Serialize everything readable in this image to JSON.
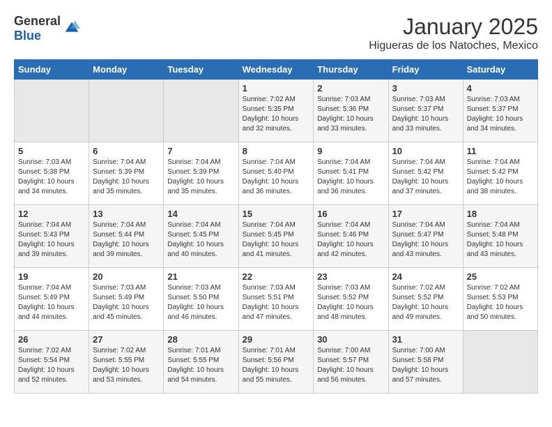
{
  "header": {
    "logo_general": "General",
    "logo_blue": "Blue",
    "month_title": "January 2025",
    "subtitle": "Higueras de los Natoches, Mexico"
  },
  "weekdays": [
    "Sunday",
    "Monday",
    "Tuesday",
    "Wednesday",
    "Thursday",
    "Friday",
    "Saturday"
  ],
  "weeks": [
    [
      {
        "day": "",
        "sunrise": "",
        "sunset": "",
        "daylight": ""
      },
      {
        "day": "",
        "sunrise": "",
        "sunset": "",
        "daylight": ""
      },
      {
        "day": "",
        "sunrise": "",
        "sunset": "",
        "daylight": ""
      },
      {
        "day": "1",
        "sunrise": "Sunrise: 7:02 AM",
        "sunset": "Sunset: 5:35 PM",
        "daylight": "Daylight: 10 hours and 32 minutes."
      },
      {
        "day": "2",
        "sunrise": "Sunrise: 7:03 AM",
        "sunset": "Sunset: 5:36 PM",
        "daylight": "Daylight: 10 hours and 33 minutes."
      },
      {
        "day": "3",
        "sunrise": "Sunrise: 7:03 AM",
        "sunset": "Sunset: 5:37 PM",
        "daylight": "Daylight: 10 hours and 33 minutes."
      },
      {
        "day": "4",
        "sunrise": "Sunrise: 7:03 AM",
        "sunset": "Sunset: 5:37 PM",
        "daylight": "Daylight: 10 hours and 34 minutes."
      }
    ],
    [
      {
        "day": "5",
        "sunrise": "Sunrise: 7:03 AM",
        "sunset": "Sunset: 5:38 PM",
        "daylight": "Daylight: 10 hours and 34 minutes."
      },
      {
        "day": "6",
        "sunrise": "Sunrise: 7:04 AM",
        "sunset": "Sunset: 5:39 PM",
        "daylight": "Daylight: 10 hours and 35 minutes."
      },
      {
        "day": "7",
        "sunrise": "Sunrise: 7:04 AM",
        "sunset": "Sunset: 5:39 PM",
        "daylight": "Daylight: 10 hours and 35 minutes."
      },
      {
        "day": "8",
        "sunrise": "Sunrise: 7:04 AM",
        "sunset": "Sunset: 5:40 PM",
        "daylight": "Daylight: 10 hours and 36 minutes."
      },
      {
        "day": "9",
        "sunrise": "Sunrise: 7:04 AM",
        "sunset": "Sunset: 5:41 PM",
        "daylight": "Daylight: 10 hours and 36 minutes."
      },
      {
        "day": "10",
        "sunrise": "Sunrise: 7:04 AM",
        "sunset": "Sunset: 5:42 PM",
        "daylight": "Daylight: 10 hours and 37 minutes."
      },
      {
        "day": "11",
        "sunrise": "Sunrise: 7:04 AM",
        "sunset": "Sunset: 5:42 PM",
        "daylight": "Daylight: 10 hours and 38 minutes."
      }
    ],
    [
      {
        "day": "12",
        "sunrise": "Sunrise: 7:04 AM",
        "sunset": "Sunset: 5:43 PM",
        "daylight": "Daylight: 10 hours and 39 minutes."
      },
      {
        "day": "13",
        "sunrise": "Sunrise: 7:04 AM",
        "sunset": "Sunset: 5:44 PM",
        "daylight": "Daylight: 10 hours and 39 minutes."
      },
      {
        "day": "14",
        "sunrise": "Sunrise: 7:04 AM",
        "sunset": "Sunset: 5:45 PM",
        "daylight": "Daylight: 10 hours and 40 minutes."
      },
      {
        "day": "15",
        "sunrise": "Sunrise: 7:04 AM",
        "sunset": "Sunset: 5:45 PM",
        "daylight": "Daylight: 10 hours and 41 minutes."
      },
      {
        "day": "16",
        "sunrise": "Sunrise: 7:04 AM",
        "sunset": "Sunset: 5:46 PM",
        "daylight": "Daylight: 10 hours and 42 minutes."
      },
      {
        "day": "17",
        "sunrise": "Sunrise: 7:04 AM",
        "sunset": "Sunset: 5:47 PM",
        "daylight": "Daylight: 10 hours and 43 minutes."
      },
      {
        "day": "18",
        "sunrise": "Sunrise: 7:04 AM",
        "sunset": "Sunset: 5:48 PM",
        "daylight": "Daylight: 10 hours and 43 minutes."
      }
    ],
    [
      {
        "day": "19",
        "sunrise": "Sunrise: 7:04 AM",
        "sunset": "Sunset: 5:49 PM",
        "daylight": "Daylight: 10 hours and 44 minutes."
      },
      {
        "day": "20",
        "sunrise": "Sunrise: 7:03 AM",
        "sunset": "Sunset: 5:49 PM",
        "daylight": "Daylight: 10 hours and 45 minutes."
      },
      {
        "day": "21",
        "sunrise": "Sunrise: 7:03 AM",
        "sunset": "Sunset: 5:50 PM",
        "daylight": "Daylight: 10 hours and 46 minutes."
      },
      {
        "day": "22",
        "sunrise": "Sunrise: 7:03 AM",
        "sunset": "Sunset: 5:51 PM",
        "daylight": "Daylight: 10 hours and 47 minutes."
      },
      {
        "day": "23",
        "sunrise": "Sunrise: 7:03 AM",
        "sunset": "Sunset: 5:52 PM",
        "daylight": "Daylight: 10 hours and 48 minutes."
      },
      {
        "day": "24",
        "sunrise": "Sunrise: 7:02 AM",
        "sunset": "Sunset: 5:52 PM",
        "daylight": "Daylight: 10 hours and 49 minutes."
      },
      {
        "day": "25",
        "sunrise": "Sunrise: 7:02 AM",
        "sunset": "Sunset: 5:53 PM",
        "daylight": "Daylight: 10 hours and 50 minutes."
      }
    ],
    [
      {
        "day": "26",
        "sunrise": "Sunrise: 7:02 AM",
        "sunset": "Sunset: 5:54 PM",
        "daylight": "Daylight: 10 hours and 52 minutes."
      },
      {
        "day": "27",
        "sunrise": "Sunrise: 7:02 AM",
        "sunset": "Sunset: 5:55 PM",
        "daylight": "Daylight: 10 hours and 53 minutes."
      },
      {
        "day": "28",
        "sunrise": "Sunrise: 7:01 AM",
        "sunset": "Sunset: 5:55 PM",
        "daylight": "Daylight: 10 hours and 54 minutes."
      },
      {
        "day": "29",
        "sunrise": "Sunrise: 7:01 AM",
        "sunset": "Sunset: 5:56 PM",
        "daylight": "Daylight: 10 hours and 55 minutes."
      },
      {
        "day": "30",
        "sunrise": "Sunrise: 7:00 AM",
        "sunset": "Sunset: 5:57 PM",
        "daylight": "Daylight: 10 hours and 56 minutes."
      },
      {
        "day": "31",
        "sunrise": "Sunrise: 7:00 AM",
        "sunset": "Sunset: 5:58 PM",
        "daylight": "Daylight: 10 hours and 57 minutes."
      },
      {
        "day": "",
        "sunrise": "",
        "sunset": "",
        "daylight": ""
      }
    ]
  ]
}
